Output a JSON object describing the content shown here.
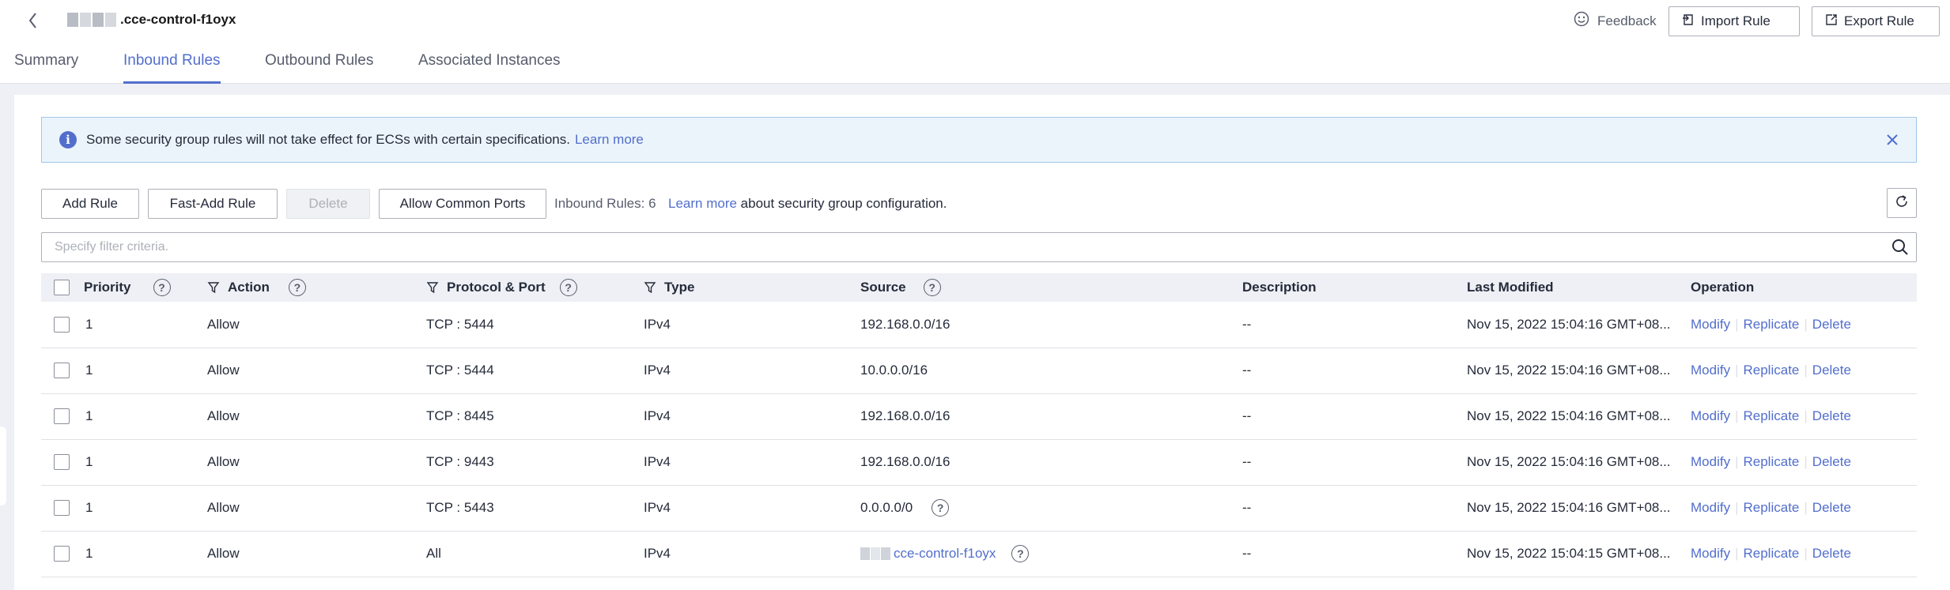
{
  "header": {
    "title": ".cce-control-f1oyx",
    "feedback_label": "Feedback",
    "import_label": "Import Rule",
    "export_label": "Export Rule"
  },
  "tabs": [
    {
      "label": "Summary"
    },
    {
      "label": "Inbound Rules"
    },
    {
      "label": "Outbound Rules"
    },
    {
      "label": "Associated Instances"
    }
  ],
  "notice": {
    "text": "Some security group rules will not take effect for ECSs with certain specifications.",
    "link": "Learn more"
  },
  "toolbar": {
    "add_rule": "Add Rule",
    "fast_add_rule": "Fast-Add Rule",
    "delete": "Delete",
    "allow_common_ports": "Allow Common Ports",
    "rule_count": "Inbound Rules: 6",
    "learn_link": "Learn more",
    "learn_suffix": " about security group configuration."
  },
  "filter": {
    "placeholder": "Specify filter criteria."
  },
  "table": {
    "columns": {
      "priority": "Priority",
      "action": "Action",
      "protocol_port": "Protocol & Port",
      "type": "Type",
      "source": "Source",
      "description": "Description",
      "last_modified": "Last Modified",
      "operation": "Operation"
    },
    "op_labels": {
      "modify": "Modify",
      "replicate": "Replicate",
      "delete": "Delete"
    },
    "rows": [
      {
        "priority": "1",
        "action": "Allow",
        "protocol_port": "TCP : 5444",
        "type": "IPv4",
        "source": "192.168.0.0/16",
        "description": "--",
        "last_modified": "Nov 15, 2022 15:04:16 GMT+08..."
      },
      {
        "priority": "1",
        "action": "Allow",
        "protocol_port": "TCP : 5444",
        "type": "IPv4",
        "source": "10.0.0.0/16",
        "description": "--",
        "last_modified": "Nov 15, 2022 15:04:16 GMT+08..."
      },
      {
        "priority": "1",
        "action": "Allow",
        "protocol_port": "TCP : 8445",
        "type": "IPv4",
        "source": "192.168.0.0/16",
        "description": "--",
        "last_modified": "Nov 15, 2022 15:04:16 GMT+08..."
      },
      {
        "priority": "1",
        "action": "Allow",
        "protocol_port": "TCP : 9443",
        "type": "IPv4",
        "source": "192.168.0.0/16",
        "description": "--",
        "last_modified": "Nov 15, 2022 15:04:16 GMT+08..."
      },
      {
        "priority": "1",
        "action": "Allow",
        "protocol_port": "TCP : 5443",
        "type": "IPv4",
        "source": "0.0.0.0/0",
        "description": "--",
        "last_modified": "Nov 15, 2022 15:04:16 GMT+08..."
      },
      {
        "priority": "1",
        "action": "Allow",
        "protocol_port": "All",
        "type": "IPv4",
        "source": "cce-control-f1oyx",
        "description": "--",
        "last_modified": "Nov 15, 2022 15:04:15 GMT+08..."
      }
    ]
  },
  "colors": {
    "accent": "#526ecc",
    "notice_bg": "#ebf4fb",
    "header_bg": "#eef0f5"
  }
}
